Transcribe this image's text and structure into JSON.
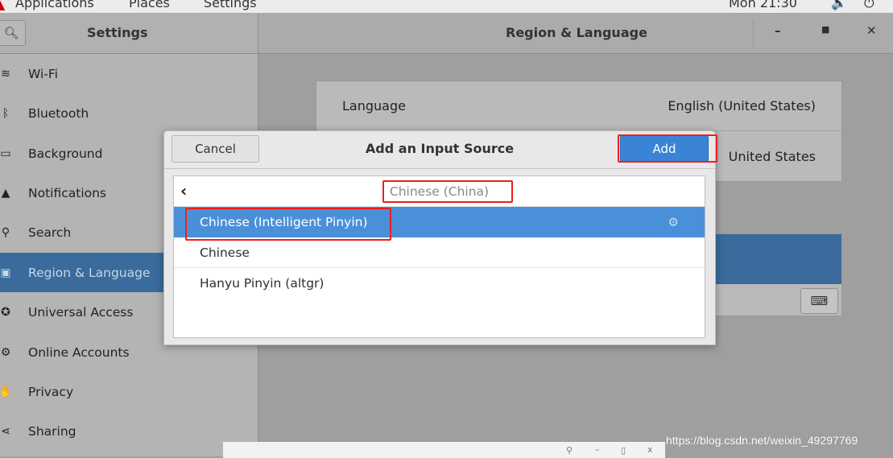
{
  "topbar": {
    "menus": [
      "Applications",
      "Places",
      "Settings"
    ],
    "clock": "Mon 21:30"
  },
  "settings_header": {
    "title": "Settings",
    "panel_title": "Region & Language"
  },
  "sidebar": {
    "items": [
      {
        "label": "Wi-Fi",
        "icon": "wifi-icon"
      },
      {
        "label": "Bluetooth",
        "icon": "bluetooth-icon"
      },
      {
        "label": "Background",
        "icon": "monitor-icon"
      },
      {
        "label": "Notifications",
        "icon": "bell-icon"
      },
      {
        "label": "Search",
        "icon": "search-icon"
      },
      {
        "label": "Region & Language",
        "icon": "camera-icon",
        "selected": true
      },
      {
        "label": "Universal Access",
        "icon": "accessibility-icon"
      },
      {
        "label": "Online Accounts",
        "icon": "online-accounts-icon"
      },
      {
        "label": "Privacy",
        "icon": "hand-icon"
      },
      {
        "label": "Sharing",
        "icon": "share-icon"
      }
    ]
  },
  "region": {
    "language_label": "Language",
    "language_value": "English (United States)",
    "formats_value": "United States"
  },
  "dialog": {
    "title": "Add an Input Source",
    "cancel": "Cancel",
    "add": "Add",
    "back_title": "Chinese (China)",
    "items": [
      {
        "label": "Chinese (Intelligent Pinyin)",
        "selected": true,
        "has_settings": true
      },
      {
        "label": "Chinese"
      },
      {
        "label": "Hanyu Pinyin (altgr)"
      }
    ]
  },
  "watermark": "https://blog.csdn.net/weixin_49297769",
  "colors": {
    "selection": "#4a90d9",
    "annotation": "#f01d1d",
    "add_button": "#3b83d6"
  }
}
